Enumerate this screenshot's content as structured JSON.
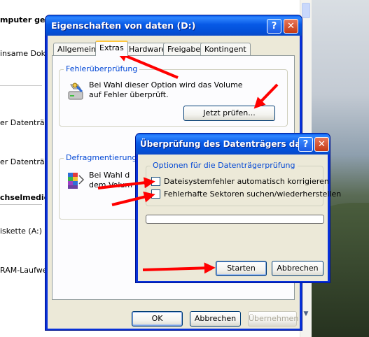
{
  "background_window": {
    "items": [
      {
        "label": "mputer gesp",
        "bold": true
      },
      {
        "label": "insame Dokum",
        "bold": false
      },
      {
        "label": "er Datenträge",
        "bold": false
      },
      {
        "label": "er Datenträge",
        "bold": false
      },
      {
        "label": "chselmedien",
        "bold": true
      },
      {
        "label": "iskette (A:)",
        "bold": false
      },
      {
        "label": "RAM-Laufwerk",
        "bold": false
      }
    ]
  },
  "properties_dialog": {
    "title": "Eigenschaften von daten (D:)",
    "help_label": "?",
    "close_label": "✕",
    "tabs": [
      {
        "label": "Allgemein",
        "active": false
      },
      {
        "label": "Extras",
        "active": true
      },
      {
        "label": "Hardware",
        "active": false
      },
      {
        "label": "Freigabe",
        "active": false
      },
      {
        "label": "Kontingent",
        "active": false
      }
    ],
    "error_check": {
      "group_title": "Fehlerüberprüfung",
      "line1": "Bei Wahl dieser Option wird das Volume",
      "line2": "auf Fehler überprüft.",
      "button_label": "Jetzt prüfen..."
    },
    "defrag": {
      "group_title": "Defragmentierung",
      "line1": "Bei Wahl d",
      "line2": "dem Volum"
    },
    "buttons": {
      "ok": "OK",
      "cancel": "Abbrechen",
      "apply": "Übernehmen"
    }
  },
  "check_disk_dialog": {
    "title": "Überprüfung des Datenträgers da...",
    "help_label": "?",
    "close_label": "✕",
    "options_group_title": "Optionen für die Datenträgerprüfung",
    "option_fix_errors": {
      "label": "Dateisystemfehler automatisch korrigieren",
      "checked": false
    },
    "option_scan_sectors": {
      "label": "Fehlerhafte Sektoren suchen/wiederherstellen",
      "checked": false
    },
    "progress": 0,
    "start_label": "Starten",
    "cancel_label": "Abbrechen"
  },
  "annotation_color": "#ff0000"
}
